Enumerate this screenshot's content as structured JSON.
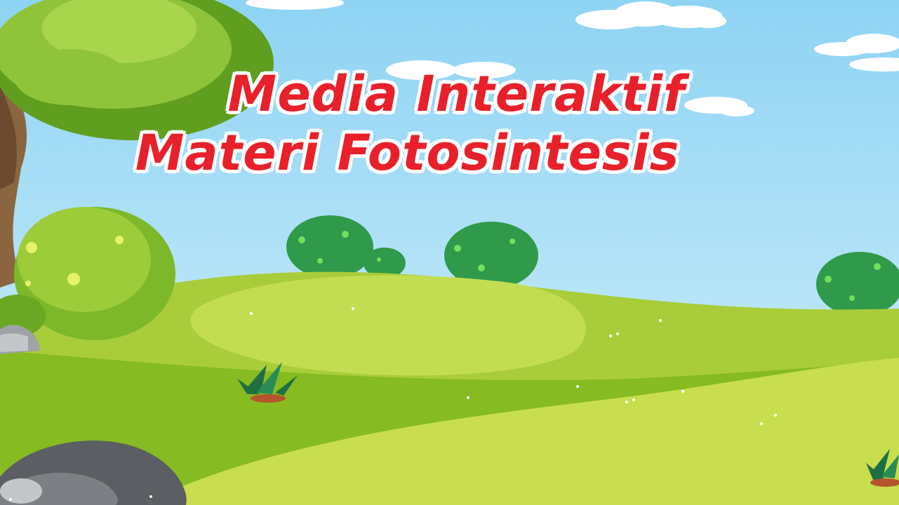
{
  "title": {
    "line1": "Media Interaktif",
    "line2": "Materi Fotosintesis"
  },
  "colors": {
    "sky_top": "#8ed3f3",
    "sky_bottom": "#c9ecfb",
    "title_red": "#e8202a",
    "grass_dark": "#7db82a",
    "grass_light": "#b9d84a",
    "bush_green": "#2f9a4a",
    "tree_leaf": "#8fc43a",
    "rock_gray": "#7c7f83"
  },
  "icons": [
    "cloud-icon",
    "tree-icon",
    "bush-icon",
    "rock-icon",
    "grass-tuft-icon",
    "flower-icon"
  ]
}
